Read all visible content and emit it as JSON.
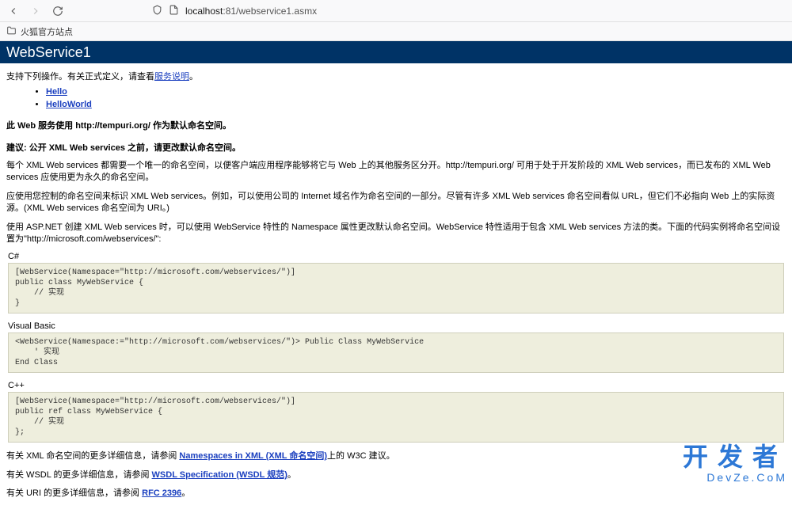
{
  "browser": {
    "url_host": "localhost",
    "url_path": ":81/webservice1.asmx",
    "bookmark": "火狐官方站点"
  },
  "header": {
    "title": "WebService1"
  },
  "intro": {
    "text_before": "支持下列操作。有关正式定义，请查看",
    "link": "服务说明",
    "text_after": "。"
  },
  "operations": [
    {
      "label": "Hello"
    },
    {
      "label": "HelloWorld"
    }
  ],
  "ns": {
    "line1": "此 Web 服务使用 http://tempuri.org/ 作为默认命名空间。",
    "line2": "建议: 公开 XML Web services 之前，请更改默认命名空间。",
    "para1": "每个 XML Web services 都需要一个唯一的命名空间，以便客户端应用程序能够将它与 Web 上的其他服务区分开。http://tempuri.org/ 可用于处于开发阶段的 XML Web services，而已发布的 XML Web services 应使用更为永久的命名空间。",
    "para2": "应使用您控制的命名空间来标识 XML Web services。例如，可以使用公司的 Internet 域名作为命名空间的一部分。尽管有许多 XML Web services 命名空间看似 URL，但它们不必指向 Web 上的实际资源。(XML Web services 命名空间为 URI。)",
    "para3": "使用 ASP.NET 创建 XML Web services 时，可以使用 WebService 特性的 Namespace 属性更改默认命名空间。WebService 特性适用于包含 XML Web services 方法的类。下面的代码实例将命名空间设置为\"http://microsoft.com/webservices/\":"
  },
  "code": {
    "csharp_label": "C#",
    "csharp": "[WebService(Namespace=\"http://microsoft.com/webservices/\")]\npublic class MyWebService {\n    // 实现\n}",
    "vb_label": "Visual Basic",
    "vb": "<WebService(Namespace:=\"http://microsoft.com/webservices/\")> Public Class MyWebService\n    ' 实现\nEnd Class",
    "cpp_label": "C++",
    "cpp": "[WebService(Namespace=\"http://microsoft.com/webservices/\")]\npublic ref class MyWebService {\n    // 实现\n};"
  },
  "footer": {
    "ns_more_before": "有关 XML 命名空间的更多详细信息，请参阅 ",
    "ns_more_link": "Namespaces in XML (XML 命名空间)",
    "ns_more_after": "上的 W3C 建议。",
    "wsdl_before": "有关 WSDL 的更多详细信息，请参阅 ",
    "wsdl_link": "WSDL Specification (WSDL 规范)",
    "wsdl_after": "。",
    "uri_before": "有关 URI 的更多详细信息，请参阅 ",
    "uri_link": "RFC 2396",
    "uri_after": "。"
  },
  "watermark": {
    "cn": "开发者",
    "en": "DevZe.CoM"
  }
}
